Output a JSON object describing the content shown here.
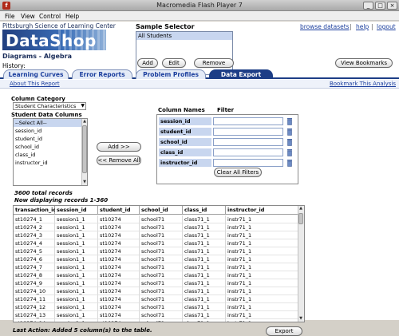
{
  "window": {
    "title": "Macromedia Flash Player 7",
    "min": "_",
    "max": "□",
    "close": "×",
    "app_icon": "f"
  },
  "menu": {
    "file": "File",
    "view": "View",
    "control": "Control",
    "help": "Help"
  },
  "header": {
    "org": "Pittsburgh Science of Learning Center",
    "logo": "DataShop",
    "dataset": "Diagrams - Algebra",
    "history_label": "History:"
  },
  "sample_selector": {
    "label": "Sample Selector",
    "items": [
      "All Students"
    ],
    "add": "Add",
    "edit": "Edit",
    "remove": "Remove"
  },
  "links": {
    "browse": "browse datasets",
    "sep": "|",
    "help": "help",
    "logout": "logout"
  },
  "view_bookmarks": "View Bookmarks",
  "tabs": [
    "Learning Curves",
    "Error Reports",
    "Problem Profiles",
    "Data Export"
  ],
  "subbar": {
    "about": "About This Report",
    "bookmark": "Bookmark This Analysis"
  },
  "column_category": {
    "label": "Column Category",
    "value": "Student Characteristics",
    "arrow": "▼"
  },
  "student_data": {
    "label": "Student Data Columns",
    "items": [
      "--Select All--",
      "session_id",
      "student_id",
      "school_id",
      "class_id",
      "instructor_id"
    ]
  },
  "buttons": {
    "add": "Add >>",
    "remove_all": "<< Remove All",
    "clear_filters": "Clear All Filters",
    "export": "Export"
  },
  "filters": {
    "col_label": "Column Names",
    "filter_label": "Filter",
    "rows": [
      "session_id",
      "student_id",
      "school_id",
      "class_id",
      "instructor_id"
    ]
  },
  "records": {
    "total": "3600 total records",
    "displaying": "Now displaying records 1-360"
  },
  "table": {
    "headers": [
      "transaction_id",
      "session_id",
      "student_id",
      "school_id",
      "class_id",
      "instructor_id"
    ],
    "rows": [
      [
        "st10274_1",
        "session1_1",
        "st10274",
        "school71",
        "class71_1",
        "instr71_1"
      ],
      [
        "st10274_2",
        "session1_1",
        "st10274",
        "school71",
        "class71_1",
        "instr71_1"
      ],
      [
        "st10274_3",
        "session1_1",
        "st10274",
        "school71",
        "class71_1",
        "instr71_1"
      ],
      [
        "st10274_4",
        "session1_1",
        "st10274",
        "school71",
        "class71_1",
        "instr71_1"
      ],
      [
        "st10274_5",
        "session1_1",
        "st10274",
        "school71",
        "class71_1",
        "instr71_1"
      ],
      [
        "st10274_6",
        "session1_1",
        "st10274",
        "school71",
        "class71_1",
        "instr71_1"
      ],
      [
        "st10274_7",
        "session1_1",
        "st10274",
        "school71",
        "class71_1",
        "instr71_1"
      ],
      [
        "st10274_8",
        "session1_1",
        "st10274",
        "school71",
        "class71_1",
        "instr71_1"
      ],
      [
        "st10274_9",
        "session1_1",
        "st10274",
        "school71",
        "class71_1",
        "instr71_1"
      ],
      [
        "st10274_10",
        "session1_1",
        "st10274",
        "school71",
        "class71_1",
        "instr71_1"
      ],
      [
        "st10274_11",
        "session1_1",
        "st10274",
        "school71",
        "class71_1",
        "instr71_1"
      ],
      [
        "st10274_12",
        "session1_1",
        "st10274",
        "school71",
        "class71_1",
        "instr71_1"
      ],
      [
        "st10274_13",
        "session1_1",
        "st10274",
        "school71",
        "class71_1",
        "instr71_1"
      ],
      [
        "st10274_14",
        "session1_1",
        "st10274",
        "school71",
        "class71_1",
        "instr71_1"
      ]
    ]
  },
  "last_action": "Last Action: Added 5 column(s) to the table."
}
